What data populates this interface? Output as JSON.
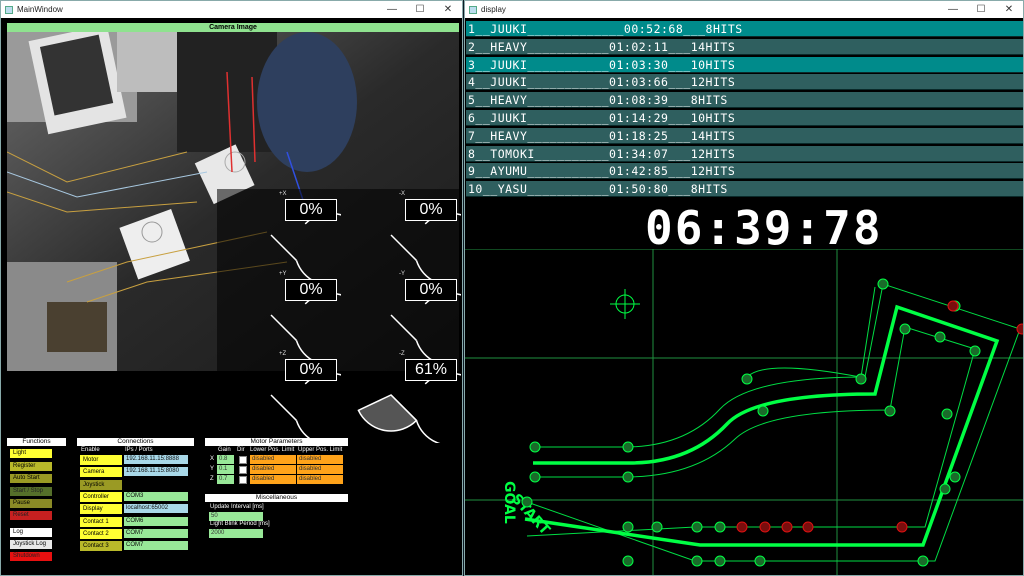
{
  "main_window": {
    "title": "MainWindow",
    "camera_header": "Camera Image",
    "gauges": [
      {
        "label": "+X",
        "value": "0%",
        "fill": 0
      },
      {
        "label": "-X",
        "value": "0%",
        "fill": 0
      },
      {
        "label": "+Y",
        "value": "0%",
        "fill": 0
      },
      {
        "label": "-Y",
        "value": "0%",
        "fill": 0
      },
      {
        "label": "+Z",
        "value": "0%",
        "fill": 0
      },
      {
        "label": "-Z",
        "value": "61%",
        "fill": 0.61
      }
    ],
    "functions": {
      "title": "Functions",
      "buttons": [
        {
          "label": "Light",
          "color": "#ffff33"
        },
        {
          "label": "Register",
          "color": "#b9b92a"
        },
        {
          "label": "Auto Start",
          "color": "#9a9a24"
        },
        {
          "label": "Start / Stop",
          "color": "#556f2a"
        },
        {
          "label": "Pause",
          "color": "#8a8a26"
        },
        {
          "label": "Reset",
          "color": "#c62020"
        },
        {
          "label": "Log",
          "color": "#ffffff"
        },
        {
          "label": "Joystick Log",
          "color": "#e8e8e8"
        },
        {
          "label": "Shutdown",
          "color": "#e81010"
        }
      ]
    },
    "connections": {
      "title": "Connections",
      "col_enable": "Enable",
      "col_ips": "IPs / Ports",
      "rows": [
        {
          "label": "Motor",
          "value": "192.168.11.15:8888",
          "color": "#ffff33",
          "vcolor": "#a8d8e8"
        },
        {
          "label": "Camera",
          "value": "192.168.11.15:8080",
          "color": "#ffff33",
          "vcolor": "#a8d8e8"
        },
        {
          "label": "Joystick",
          "value": "",
          "color": "#9a9a24",
          "vcolor": ""
        },
        {
          "label": "Controller",
          "value": "COM3",
          "color": "#ffff33",
          "vcolor": "#98e898"
        },
        {
          "label": "Display",
          "value": "localhost:65002",
          "color": "#ffff33",
          "vcolor": "#a8d8e8"
        },
        {
          "label": "Contact 1",
          "value": "COM6",
          "color": "#ffff33",
          "vcolor": "#98e898"
        },
        {
          "label": "Contact 2",
          "value": "COM7",
          "color": "#ffff33",
          "vcolor": "#98e898"
        },
        {
          "label": "Contact 3",
          "value": "COM7",
          "color": "#b9b92a",
          "vcolor": "#98e898"
        }
      ]
    },
    "motor_params": {
      "title": "Motor Parameters",
      "col_gain": "Gain",
      "col_dir": "Dir",
      "col_lower": "Lower Pos. Limit",
      "col_upper": "Upper Pos. Limit",
      "rows": [
        {
          "axis": "X",
          "gain": "0.8",
          "lower": "disabled",
          "upper": "disabled"
        },
        {
          "axis": "Y",
          "gain": "0.1",
          "lower": "disabled",
          "upper": "disabled"
        },
        {
          "axis": "Z",
          "gain": "0.7",
          "lower": "disabled",
          "upper": "disabled"
        }
      ]
    },
    "misc": {
      "title": "Miscellaneous",
      "update_label": "Update Interval [ms]",
      "update_value": "50",
      "blink_label": "Light Blink Period [ms]",
      "blink_value": "2000"
    }
  },
  "display_window": {
    "title": "display",
    "ranking": [
      "1__JUUKI_____________00:52:68___8HITS",
      "2__HEAVY___________01:02:11___14HITS",
      "3__JUUKI___________01:03:30___10HITS",
      "4__JUUKI___________01:03:66___12HITS",
      "5__HEAVY___________01:08:39___8HITS",
      "6__JUUKI___________01:14:29___10HITS",
      "7__HEAVY___________01:18:25___14HITS",
      "8__TOMOKI__________01:34:07___12HITS",
      "9__AYUMU___________01:42:85___12HITS",
      "10__YASU___________01:50:80___8HITS"
    ],
    "timer": "06:39:78",
    "goal_label": "GOAL",
    "start_label": "START",
    "colors": {
      "row_highlight": "#008b8b",
      "row_normal": "#2f5f5f",
      "track": "#00ff44",
      "hit": "#dd1111"
    }
  }
}
